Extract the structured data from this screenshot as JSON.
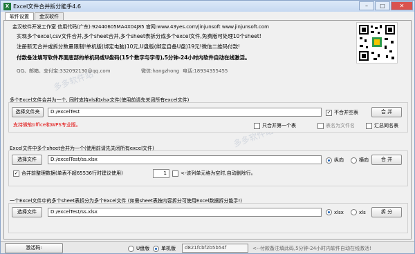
{
  "window": {
    "title": "Excel文件合并拆分能手4.6",
    "app_icon": "X",
    "minimize": "–",
    "maximize": "□",
    "close": "✕"
  },
  "tabs": [
    "软件设置",
    "金汉软件"
  ],
  "info": {
    "line1": "金汉软件开发工作室 信用代码(广东):92440605MA4X04J85 官网:www.43yes.com/jinjunsoft  www.jinjunsoft.com",
    "line2": "实现多个excel,csv文件合并,多个sheet合并,多个sheet表拆分成多个excel文件,免费版可处理10个sheet!",
    "line3": "注册新无合并或拆分数量限制!单机版(绑定电脑)10元,U盘版(绑定自备U盘)19元!微信二维码付款!",
    "line4": "付款备注填写软件界面底部的单机码或U盘码(15个数字与字母),5分钟-24小时内软件自动在线激活。",
    "line5_qq": "QQ、邮箱、支付宝:332092130@qq.com",
    "line5_wx": "微信:hangzhong",
    "line5_tel": "电话:18934355455"
  },
  "section1": {
    "label": "多个Excel文件合并为一个, 同时支持xls和xlsx文件(使用前请先关闭所有excel文件)",
    "select_button": "选择文件夹",
    "path": "D:/excelTest",
    "no_merge_blank": "不合并空表",
    "merge_button": "合 并",
    "note": "支持微软office和WPS专业版。",
    "only_first": "只合并第一个表",
    "sheet_as_filename": "表名为文件名",
    "summary_same_name": "汇总同名表"
  },
  "section2": {
    "label": "Excel文件中多个sheet合并为一个(使用前请先关闭所有excel文件)",
    "select_button": "选择文件",
    "path": "D:/excelTest/ss.xlsx",
    "vertical": "纵向",
    "horizontal": "横向",
    "merge_format": "合并前整理数据(单表不超65536行时建议使用)",
    "stepper_value": "1",
    "blank_row_note": "<-该列单元格为空时,自动删除行。",
    "merge_button": "合 并"
  },
  "section3": {
    "label": "一个Excel文件中的多个sheet表拆分为多个Excel文件 (如需sheet表按内容拆分可使用Excel数据拆分能手!)",
    "select_button": "选择文件",
    "path": "D:/excelTest/ss.xlsx",
    "xlsx": "xlsx",
    "xls": "xls",
    "split_button": "拆 分"
  },
  "statusbar": {
    "activate_button": "激活码:",
    "udisk": "U盘版",
    "single": "单机版",
    "machine_code": "d821fcbf2b5b54f",
    "note": "<--付款备注填此码,5分钟-24小时内软件自动在线激活!"
  },
  "watermark": "多多软件站",
  "colors": {
    "accent": "#1a5fb4",
    "red": "#e00000",
    "green": "#1f7a3a"
  }
}
